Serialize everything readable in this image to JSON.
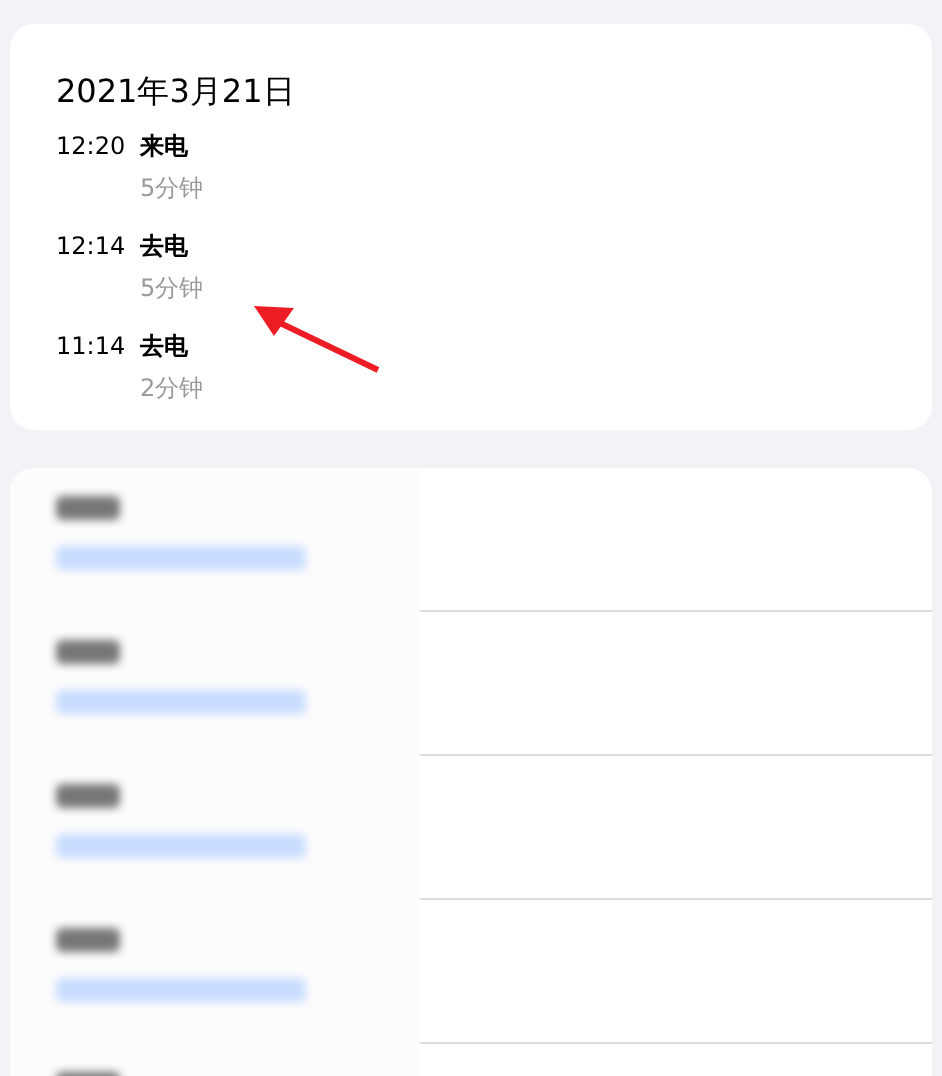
{
  "date": "2021年3月21日",
  "calls": [
    {
      "time": "12:20",
      "type": "来电",
      "duration": "5分钟"
    },
    {
      "time": "12:14",
      "type": "去电",
      "duration": "5分钟"
    },
    {
      "time": "11:14",
      "type": "去电",
      "duration": "2分钟"
    }
  ],
  "blurred_rows": [
    {
      "kind": "blurred"
    },
    {
      "kind": "blurred"
    },
    {
      "kind": "blurred"
    },
    {
      "kind": "blurred"
    },
    {
      "kind": "cut_off"
    }
  ]
}
